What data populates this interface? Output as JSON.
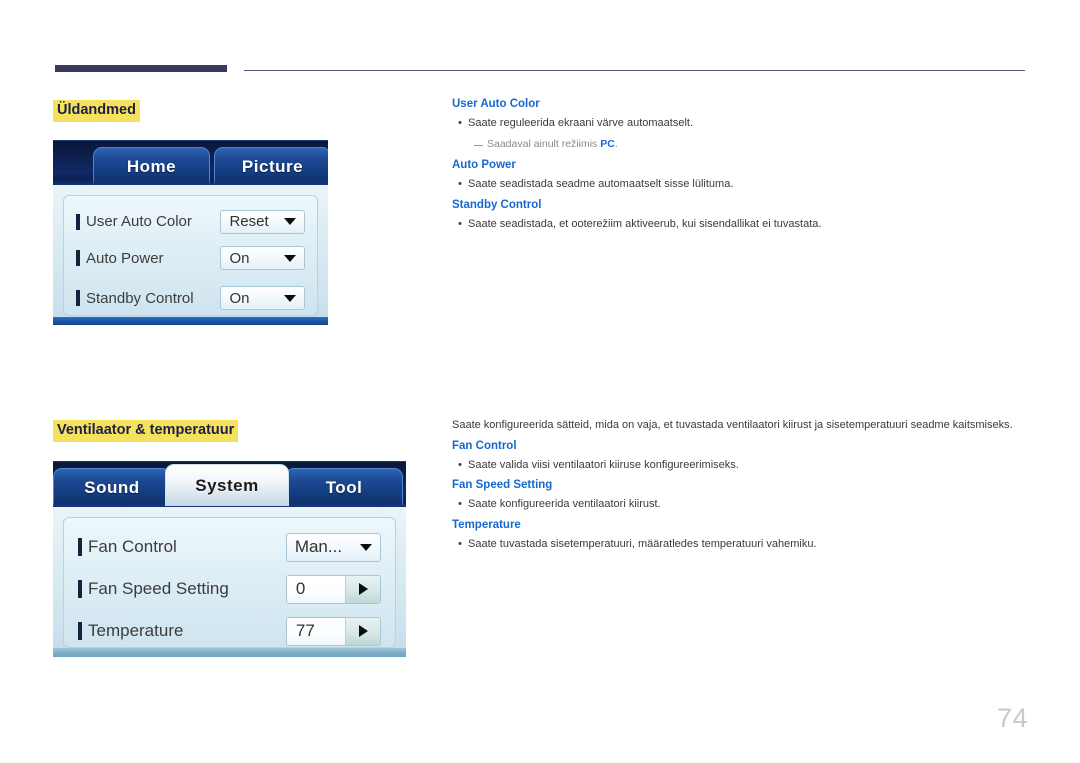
{
  "page": {
    "number": "74",
    "accent_yellow": "#f4e15e",
    "accent_blue": "#1669d0",
    "rule_navy": "#39395f"
  },
  "sections": [
    {
      "heading": "Üldandmed",
      "osd": {
        "tabs": [
          {
            "label": "Home",
            "state": "inactive"
          },
          {
            "label": "Picture",
            "state": "inactive"
          },
          {
            "label": "",
            "state": "inactive"
          }
        ],
        "rows": [
          {
            "label": "User Auto Color",
            "control": "combo",
            "value": "Reset"
          },
          {
            "label": "Auto Power",
            "control": "combo",
            "value": "On"
          },
          {
            "label": "Standby Control",
            "control": "combo",
            "value": "On"
          }
        ]
      },
      "text": {
        "intro": "",
        "items": [
          {
            "head": "User Auto Color",
            "body": "Saate reguleerida ekraani värve automaatselt.",
            "note_prefix": "Saadaval ainult režiimis ",
            "note_bold": "PC",
            "note_suffix": "."
          },
          {
            "head": "Auto Power",
            "body": "Saate seadistada seadme automaatselt sisse lülituma."
          },
          {
            "head": "Standby Control",
            "body": "Saate seadistada, et ooterežiim aktiveerub, kui sisendallikat ei tuvastata."
          }
        ]
      }
    },
    {
      "heading": "Ventilaator & temperatuur",
      "osd": {
        "tabs": [
          {
            "label": "Sound",
            "state": "inactive"
          },
          {
            "label": "System",
            "state": "active"
          },
          {
            "label": "Tool",
            "state": "inactive"
          }
        ],
        "rows": [
          {
            "label": "Fan Control",
            "control": "combo",
            "value": "Man..."
          },
          {
            "label": "Fan Speed Setting",
            "control": "spin",
            "value": "0"
          },
          {
            "label": "Temperature",
            "control": "spin",
            "value": "77"
          }
        ]
      },
      "text": {
        "intro": "Saate konfigureerida sätteid, mida on vaja, et tuvastada ventilaatori kiirust ja sisetemperatuuri seadme kaitsmiseks.",
        "items": [
          {
            "head": "Fan Control",
            "body": "Saate valida viisi ventilaatori kiiruse konfigureerimiseks."
          },
          {
            "head": "Fan Speed Setting",
            "body": "Saate konfigureerida ventilaatori kiirust."
          },
          {
            "head": "Temperature",
            "body": "Saate tuvastada sisetemperatuuri, määratledes temperatuuri vahemiku."
          }
        ]
      }
    }
  ]
}
